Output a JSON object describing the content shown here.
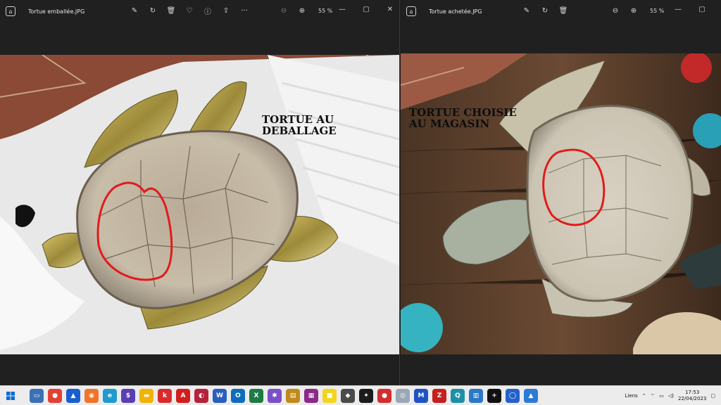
{
  "left_window": {
    "title": "Tortue emballée.JPG",
    "zoom": "55 %",
    "caption": "TORTUE AU\nDEBALLAGE"
  },
  "right_window": {
    "title": "Tortue achetée.JPG",
    "zoom": "55 %",
    "caption": "TORTUE CHOISIE\nAU MAGASIN"
  },
  "toolbar_icons": [
    "edit-icon",
    "rotate-icon",
    "delete-icon",
    "favorite-icon",
    "info-icon",
    "share-icon",
    "more-icon"
  ],
  "taskbar": {
    "apps": [
      {
        "name": "task-view-icon",
        "color": "#3b6fb6",
        "glyph": "▭"
      },
      {
        "name": "chrome-icon",
        "color": "#e44134",
        "glyph": "●"
      },
      {
        "name": "arc-icon",
        "color": "#1a5fd1",
        "glyph": "▲"
      },
      {
        "name": "firefox-icon",
        "color": "#f1742a",
        "glyph": "◉"
      },
      {
        "name": "edge-icon",
        "color": "#1f9bcd",
        "glyph": "e"
      },
      {
        "name": "money-icon",
        "color": "#5a3fb3",
        "glyph": "$"
      },
      {
        "name": "file-explorer-icon",
        "color": "#f2b300",
        "glyph": "▬"
      },
      {
        "name": "kobo-icon",
        "color": "#d92b2b",
        "glyph": "k"
      },
      {
        "name": "acrobat-icon",
        "color": "#d31d1d",
        "glyph": "A"
      },
      {
        "name": "app-icon",
        "color": "#b5223a",
        "glyph": "◐"
      },
      {
        "name": "word-icon",
        "color": "#2b5fbd",
        "glyph": "W"
      },
      {
        "name": "outlook-icon",
        "color": "#0f6cbd",
        "glyph": "O"
      },
      {
        "name": "excel-icon",
        "color": "#1e7b45",
        "glyph": "X"
      },
      {
        "name": "puzzle-icon",
        "color": "#7a4fc9",
        "glyph": "✱"
      },
      {
        "name": "notes-icon",
        "color": "#c08a1c",
        "glyph": "▤"
      },
      {
        "name": "grid-app-icon",
        "color": "#8a2a8a",
        "glyph": "▦"
      },
      {
        "name": "sticky-notes-icon",
        "color": "#f4d41a",
        "glyph": "■"
      },
      {
        "name": "app2-icon",
        "color": "#4a4a4a",
        "glyph": "◆"
      },
      {
        "name": "game-icon",
        "color": "#1c1c1c",
        "glyph": "✦"
      },
      {
        "name": "record-icon",
        "color": "#d32f2f",
        "glyph": "●"
      },
      {
        "name": "app3-icon",
        "color": "#9aa8b6",
        "glyph": "◎"
      },
      {
        "name": "m-app-icon",
        "color": "#1f52c5",
        "glyph": "M"
      },
      {
        "name": "filezilla-icon",
        "color": "#c4201f",
        "glyph": "Z"
      },
      {
        "name": "search-app-icon",
        "color": "#1f8fa8",
        "glyph": "Q"
      },
      {
        "name": "calculator-icon",
        "color": "#2a78c6",
        "glyph": "▥"
      },
      {
        "name": "plus-app-icon",
        "color": "#111111",
        "glyph": "+"
      },
      {
        "name": "circle-app-icon",
        "color": "#2561c8",
        "glyph": "◯"
      },
      {
        "name": "photos-icon",
        "color": "#2a7ad6",
        "glyph": "▲"
      }
    ],
    "links_label": "Liens",
    "time": "17:53",
    "date": "22/04/2023"
  }
}
